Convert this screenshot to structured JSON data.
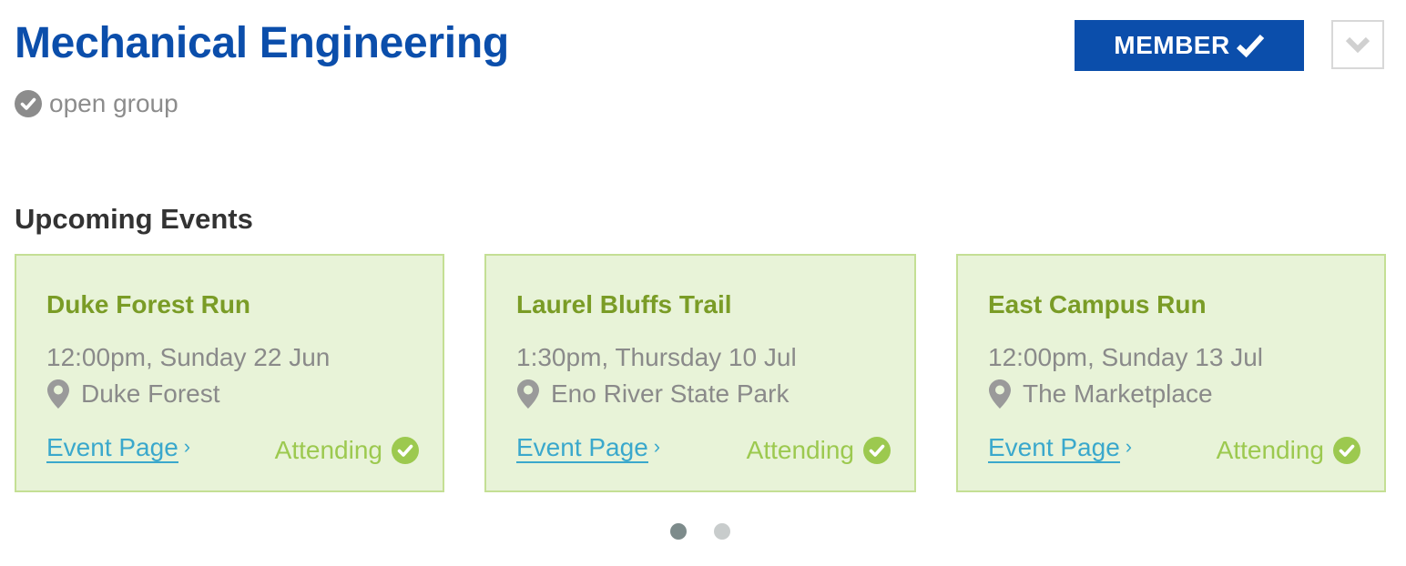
{
  "group": {
    "title": "Mechanical Engineering",
    "type_label": "open group",
    "type_icon": "check-circle-icon"
  },
  "membership": {
    "button_label": "MEMBER",
    "button_icon": "checkmark-icon",
    "dropdown_icon": "chevron-down-icon"
  },
  "events": {
    "section_title": "Upcoming Events",
    "items": [
      {
        "name": "Duke Forest Run",
        "datetime": "12:00pm, Sunday 22 Jun",
        "location": "Duke Forest",
        "link_label": "Event Page",
        "status": "Attending"
      },
      {
        "name": "Laurel Bluffs Trail",
        "datetime": "1:30pm, Thursday 10 Jul",
        "location": "Eno River State Park",
        "link_label": "Event Page",
        "status": "Attending"
      },
      {
        "name": "East Campus Run",
        "datetime": "12:00pm, Sunday 13 Jul",
        "location": "The Marketplace",
        "link_label": "Event Page",
        "status": "Attending"
      }
    ]
  },
  "pagination": {
    "pages": 2,
    "current": 1
  },
  "colors": {
    "brand": "#0b4eab",
    "card_bg": "#e8f3d8",
    "card_border": "#c4df94",
    "event_title": "#7a9c26",
    "link": "#3aa8cc",
    "attending": "#9cc94f",
    "dot_active": "#7d8b8b",
    "dot_inactive": "#c8cccc"
  }
}
